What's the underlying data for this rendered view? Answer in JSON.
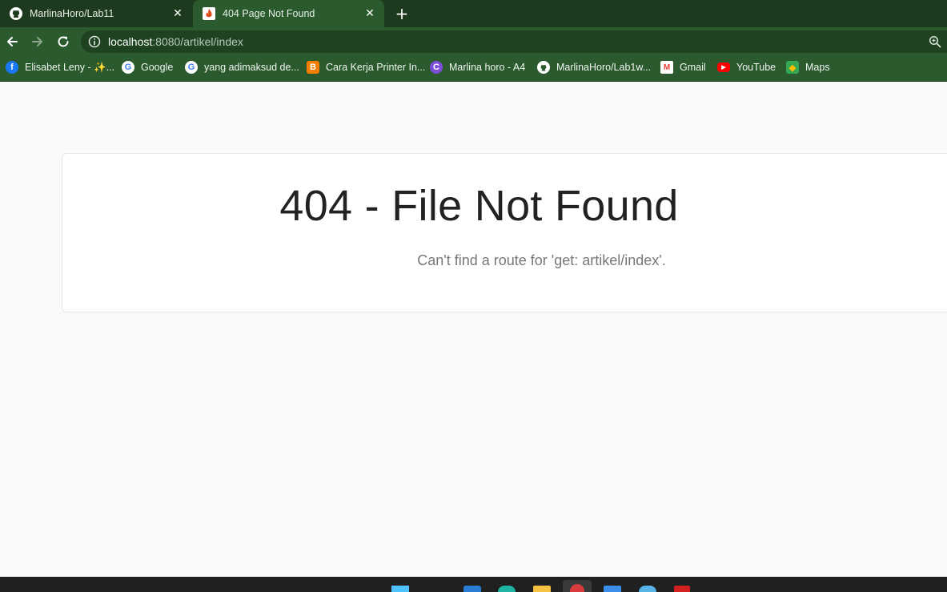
{
  "tabs": [
    {
      "label": "MarlinaHoro/Lab11",
      "icon": "github-icon",
      "close": "✕"
    },
    {
      "label": "404 Page Not Found",
      "icon": "codeigniter-icon",
      "close": "✕"
    }
  ],
  "new_tab": "+",
  "address_bar": {
    "host": "localhost",
    "rest": ":8080/artikel/index"
  },
  "bookmarks": [
    {
      "label": "Elisabet Leny - ✨...",
      "icon": "facebook-icon",
      "color": "#1877f2"
    },
    {
      "label": "Google",
      "icon": "google-icon",
      "color": "#ffffff"
    },
    {
      "label": "yang adimaksud de...",
      "icon": "google-icon",
      "color": "#ffffff"
    },
    {
      "label": "Cara Kerja Printer In...",
      "icon": "blogger-icon",
      "color": "#f57d00"
    },
    {
      "label": "Marlina horo - A4",
      "icon": "canva-icon",
      "color": "#7d4ed8"
    },
    {
      "label": "MarlinaHoro/Lab1w...",
      "icon": "github-icon",
      "color": "#ffffff"
    },
    {
      "label": "Gmail",
      "icon": "gmail-icon",
      "color": "#ea4335"
    },
    {
      "label": "YouTube",
      "icon": "youtube-icon",
      "color": "#ff0000"
    },
    {
      "label": "Maps",
      "icon": "maps-icon",
      "color": "#34a853"
    }
  ],
  "page": {
    "title": "404 - File Not Found",
    "message": "Can't find a route for 'get: artikel/index'."
  },
  "colors": {
    "tabstrip": "#1d3a1e",
    "toolbar": "#2a5a2d",
    "page_background": "#fafafa",
    "card_background": "#ffffff",
    "title_text": "#222222",
    "message_text": "#777777"
  }
}
